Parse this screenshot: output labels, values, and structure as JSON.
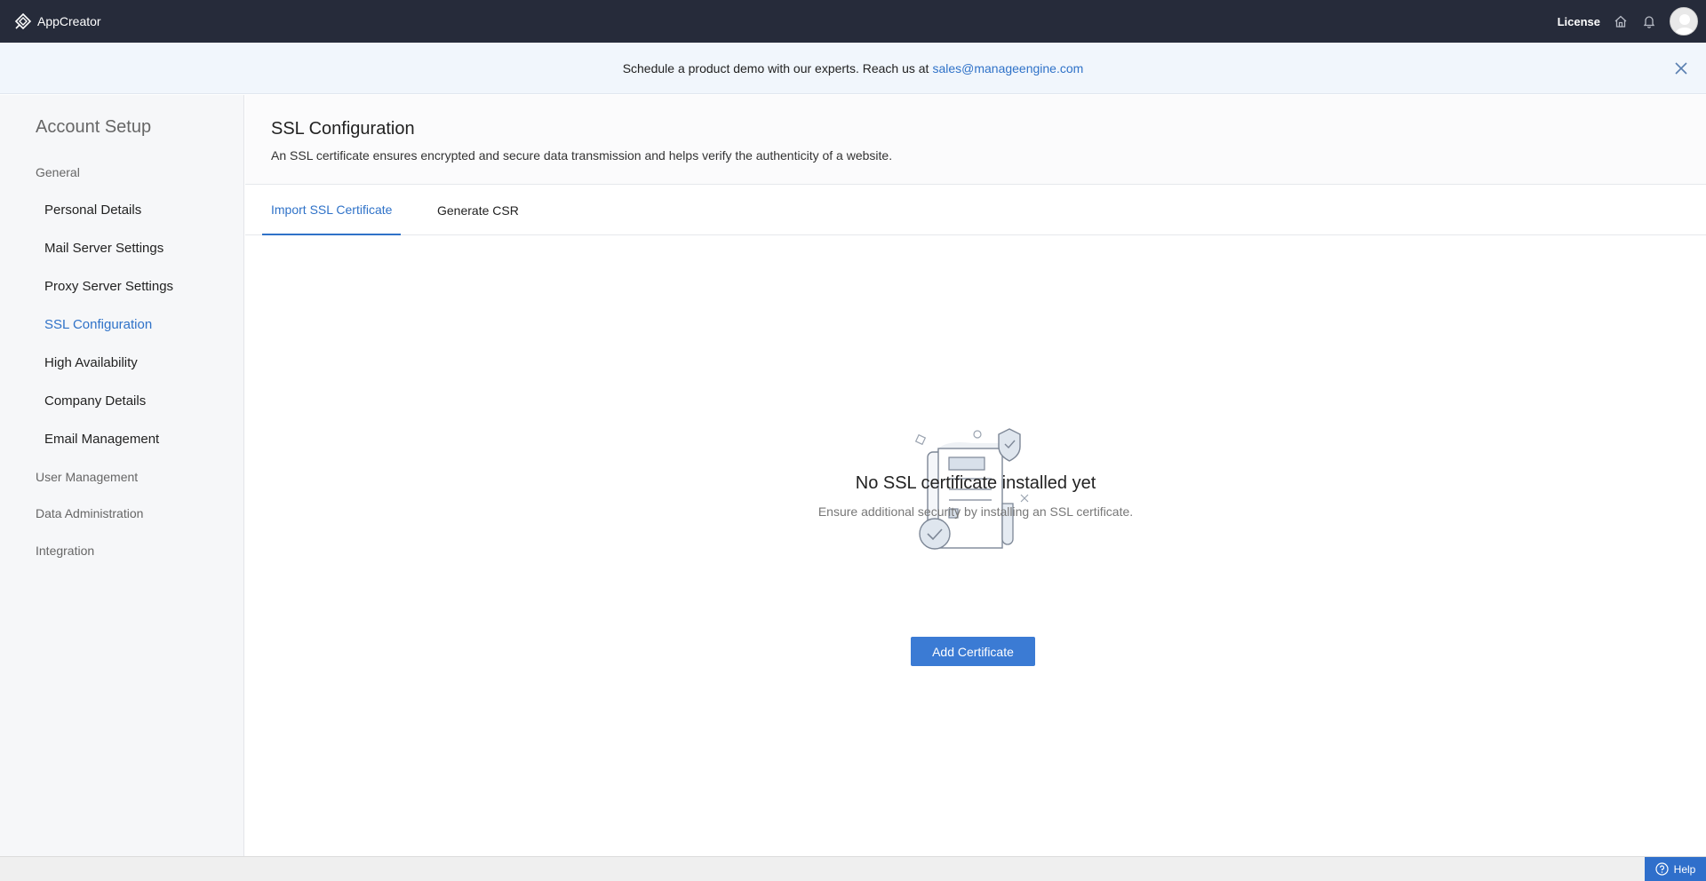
{
  "app": {
    "name": "AppCreator",
    "logo_icon": "appcreator-logo-icon"
  },
  "topbar": {
    "license_label": "License",
    "icons": [
      "home-icon",
      "bell-icon",
      "avatar"
    ]
  },
  "banner": {
    "text": "Schedule a product demo with our experts. Reach us at",
    "email": "sales@manageengine.com",
    "close_icon": "close-icon"
  },
  "sidebar": {
    "title": "Account Setup",
    "groups": [
      {
        "label": "General",
        "items": [
          {
            "label": "Personal Details",
            "active": false
          },
          {
            "label": "Mail Server Settings",
            "active": false
          },
          {
            "label": "Proxy Server Settings",
            "active": false
          },
          {
            "label": "SSL Configuration",
            "active": true
          },
          {
            "label": "High Availability",
            "active": false
          },
          {
            "label": "Company Details",
            "active": false
          },
          {
            "label": "Email Management",
            "active": false
          }
        ]
      },
      {
        "label": "User Management",
        "items": []
      },
      {
        "label": "Data Administration",
        "items": []
      },
      {
        "label": "Integration",
        "items": []
      }
    ]
  },
  "main": {
    "title": "SSL Configuration",
    "description": "An SSL certificate ensures encrypted and secure data transmission and helps verify the authenticity of a website.",
    "tabs": [
      {
        "label": "Import SSL Certificate",
        "active": true
      },
      {
        "label": "Generate CSR",
        "active": false
      }
    ],
    "empty_state": {
      "illustration": "certificate-illustration",
      "title": "No SSL certificate installed yet",
      "description": "Ensure additional security by installing an SSL certificate.",
      "button_label": "Add Certificate"
    }
  },
  "footer": {
    "help_label": "Help"
  },
  "colors": {
    "topbar": "#262b3a",
    "accent": "#2f72c8",
    "button": "#3b7bd4",
    "banner_bg": "#f1f6fc",
    "sidebar_bg": "#f6f7f9"
  }
}
